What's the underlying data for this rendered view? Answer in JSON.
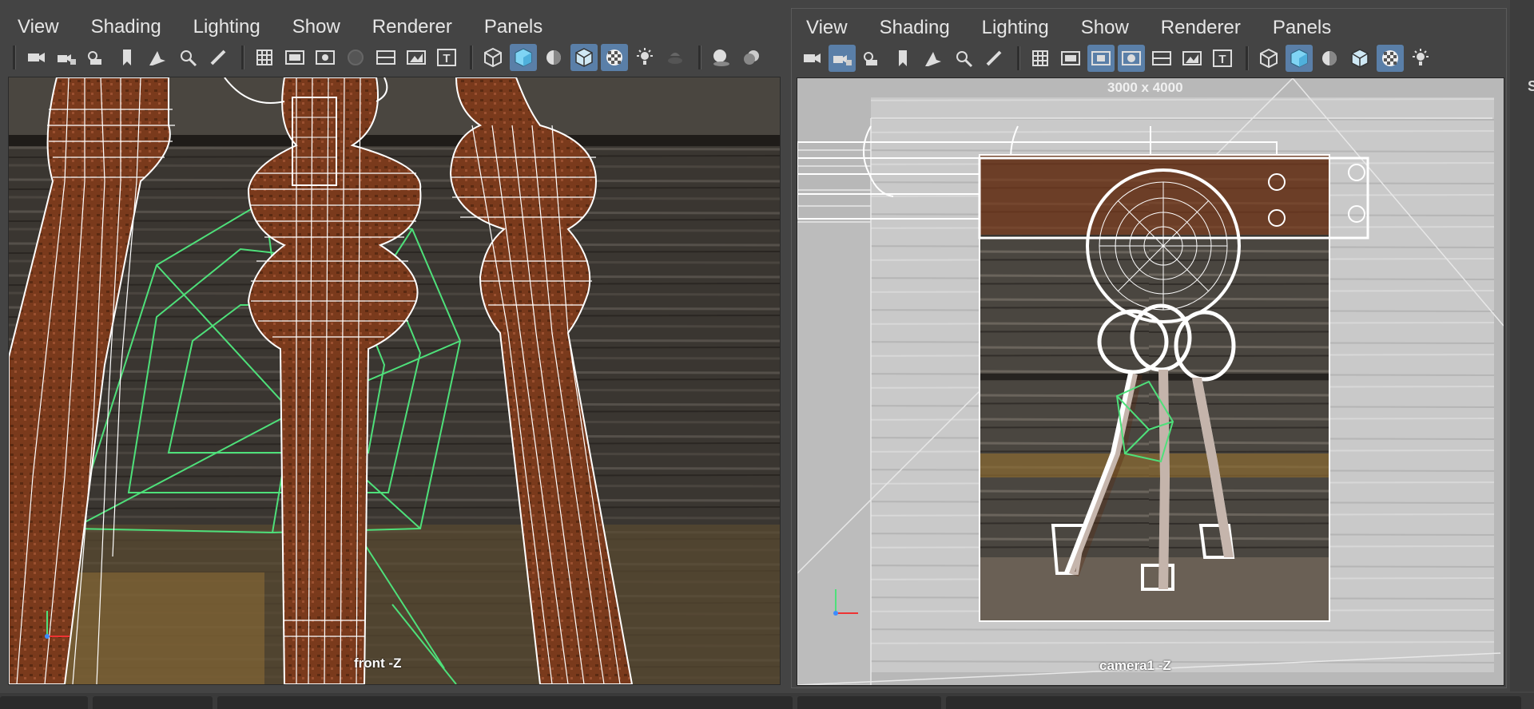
{
  "left_panel": {
    "menu": [
      "View",
      "Shading",
      "Lighting",
      "Show",
      "Renderer",
      "Panels"
    ],
    "camera_label": "front -Z"
  },
  "right_panel": {
    "menu": [
      "View",
      "Shading",
      "Lighting",
      "Show",
      "Renderer",
      "Panels"
    ],
    "camera_label": "camera1 -Z",
    "resolution_label": "3000 x 4000"
  },
  "side": {
    "letter": "S"
  },
  "icons": {
    "toolbar_left": [
      "select-camera-icon",
      "lock-camera-icon",
      "camera-attributes-icon",
      "bookmark-icon",
      "image-plane-icon",
      "2d-pan-zoom-icon",
      "grease-pencil-icon",
      "grid-icon",
      "film-gate-icon",
      "resolution-gate-icon",
      "gate-mask-icon",
      "field-chart-icon",
      "safe-action-icon",
      "safe-title-icon",
      "wireframe-icon",
      "smooth-shade-icon",
      "use-default-material-icon",
      "wireframe-on-shaded-icon",
      "textured-icon",
      "lights-icon",
      "shadows-icon",
      "screen-space-ao-icon",
      "motion-blur-icon"
    ],
    "toolbar_right": [
      "select-camera-icon",
      "lock-camera-icon",
      "camera-attributes-icon",
      "bookmark-icon",
      "image-plane-icon",
      "2d-pan-zoom-icon",
      "grease-pencil-icon",
      "grid-icon",
      "film-gate-icon",
      "resolution-gate-icon",
      "gate-mask-icon",
      "field-chart-icon",
      "safe-action-icon",
      "safe-title-icon",
      "wireframe-icon",
      "smooth-shade-icon",
      "use-default-material-icon",
      "wireframe-on-shaded-icon",
      "textured-icon",
      "lights-icon"
    ]
  },
  "colors": {
    "ui_background": "#444444",
    "active_button": "#5a7fa8",
    "wire_white": "#ffffff",
    "wire_green": "#4ee07a",
    "wood_dark": "#3c3833",
    "rust": "#7a3a1c",
    "gray_background": "#c8c8c8"
  }
}
